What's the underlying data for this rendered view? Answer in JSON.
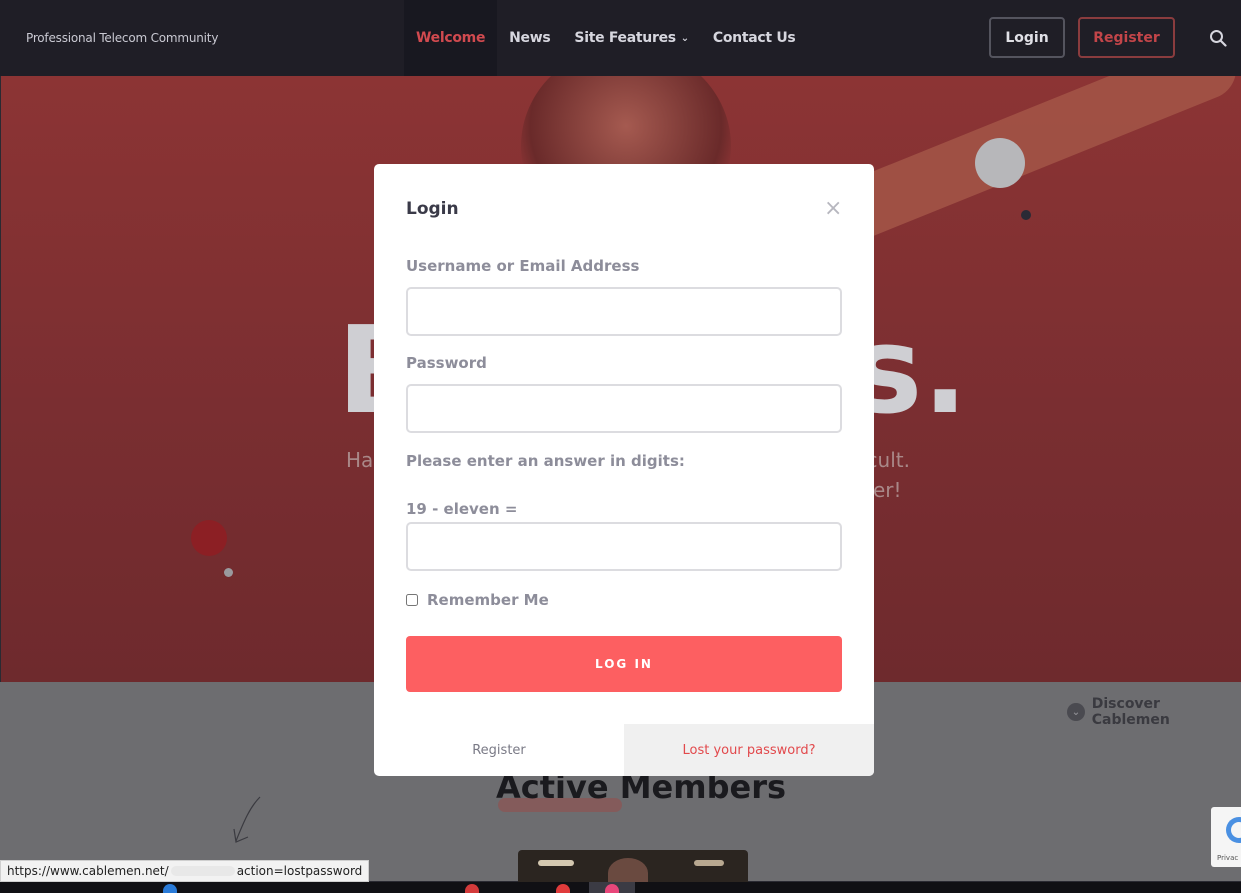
{
  "header": {
    "brand": "Professional Telecom Community",
    "nav": [
      {
        "label": "Welcome"
      },
      {
        "label": "News"
      },
      {
        "label": "Site Features"
      },
      {
        "label": "Contact Us"
      }
    ],
    "login_label": "Login",
    "register_label": "Register"
  },
  "hero": {
    "title_start": "B",
    "title_end": "s.",
    "sub_line1_start": "Ha",
    "sub_line1_end": "icult.",
    "sub_line2_end": "er!"
  },
  "discover": {
    "label": "Discover Cablemen"
  },
  "members": {
    "title": "Active Members"
  },
  "modal": {
    "title": "Login",
    "username_label": "Username or Email Address",
    "username_value": "",
    "password_label": "Password",
    "password_value": "",
    "captcha_prompt": "Please enter an answer in digits:",
    "captcha_question": "19 - eleven =",
    "captcha_value": "",
    "remember_label": "Remember Me",
    "submit_label": "LOG IN",
    "footer_register": "Register",
    "footer_lost": "Lost your password?"
  },
  "status_url": {
    "prefix": "https://www.cablemen.net/",
    "suffix": "action=lostpassword"
  },
  "recaptcha": {
    "text": "Privac"
  },
  "colors": {
    "accent": "#fd5f61",
    "nav_bg": "#1f1e26",
    "active_nav": "#d14a4f"
  }
}
